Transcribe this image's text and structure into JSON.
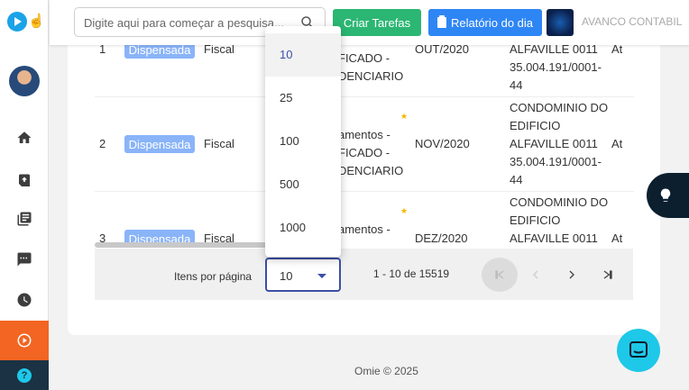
{
  "sidebar": {
    "items": [
      {
        "name": "home-icon"
      },
      {
        "name": "upload-file-icon"
      },
      {
        "name": "book-icon"
      },
      {
        "name": "chat-icon"
      },
      {
        "name": "clock-icon"
      },
      {
        "name": "play-icon"
      },
      {
        "name": "help-icon",
        "label": "?"
      }
    ],
    "active_color": "#f26522"
  },
  "header": {
    "search_placeholder": "Digite aqui para começar a pesquisa...",
    "create_tasks_label": "Criar Tarefas",
    "report_label": "Relatório do dia",
    "company_name": "AVANCO CONTABIL"
  },
  "table": {
    "rows": [
      {
        "num": "1",
        "status": "Dispensada",
        "type": "Fiscal",
        "desc": [
          "FICADO -",
          "DENCIARIO"
        ],
        "period": "OUT/2020",
        "company": [
          "ALFAVILLE 0011",
          "35.004.191/0001-",
          "44"
        ],
        "extra": "At"
      },
      {
        "num": "2",
        "status": "Dispensada",
        "type": "Fiscal",
        "desc": [
          "amentos -",
          "FICADO -",
          "DENCIARIO"
        ],
        "period": "NOV/2020",
        "company": [
          "CONDOMINIO DO",
          "EDIFICIO",
          "ALFAVILLE 0011",
          "35.004.191/0001-",
          "44"
        ],
        "extra": "At"
      },
      {
        "num": "3",
        "status": "Dispensada",
        "type": "Fiscal",
        "desc": [
          "amentos -"
        ],
        "period": "DEZ/2020",
        "company": [
          "CONDOMINIO DO",
          "EDIFICIO",
          "ALFAVILLE 0011"
        ],
        "extra": "At"
      }
    ]
  },
  "pagination": {
    "items_per_page_label": "Itens por página",
    "selected": "10",
    "range": "1 - 10 de 15519",
    "options": [
      "10",
      "25",
      "100",
      "500",
      "1000"
    ]
  },
  "footer": {
    "text": "Omie © 2025"
  },
  "colors": {
    "badge": "#8ab4f8",
    "green_button": "#2bb673",
    "blue_button": "#2e86f5",
    "select_accent": "#3b4fa8",
    "chat_button": "#1ec8e8"
  }
}
